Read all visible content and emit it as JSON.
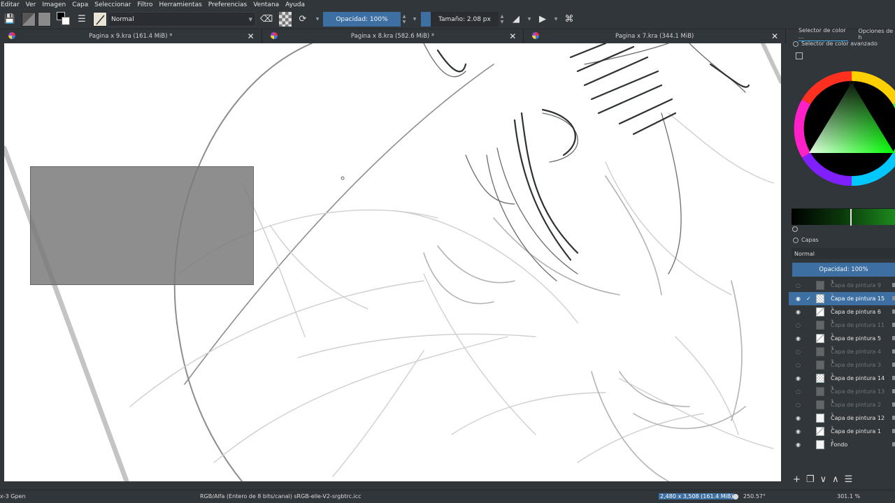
{
  "menu": [
    "Editar",
    "Ver",
    "Imagen",
    "Capa",
    "Seleccionar",
    "Filtro",
    "Herramientas",
    "Preferencias",
    "Ventana",
    "Ayuda"
  ],
  "toolbar": {
    "blend_mode": "Normal",
    "opacity_label": "Opacidad: 100%",
    "size_label": "Tamaño: 2.08 px"
  },
  "tabs": [
    {
      "title": "Pagina x 9.kra (161.4 MiB) *"
    },
    {
      "title": "Pagina x 8.kra (582.6 MiB) *"
    },
    {
      "title": "Pagina x 7.kra (344.1 MiB)"
    }
  ],
  "dock": {
    "tab_color": "Selector de color ...",
    "tab_options": "Opciones de h",
    "color_panel_title": "Selector de color avanzado",
    "layers_title": "Capas",
    "layer_blend": "Normal",
    "layer_opacity": "Opacidad:  100%"
  },
  "layers": [
    {
      "name": "Capa de pintura 9",
      "visible": false,
      "selected": false,
      "checked": false,
      "thumb": "faint"
    },
    {
      "name": "Capa de pintura 15",
      "visible": true,
      "selected": true,
      "checked": true,
      "thumb": "check"
    },
    {
      "name": "Capa de pintura 6",
      "visible": true,
      "selected": false,
      "checked": false,
      "thumb": "sketch"
    },
    {
      "name": "Capa de pintura 11",
      "visible": false,
      "selected": false,
      "checked": false,
      "thumb": "faint"
    },
    {
      "name": "Capa de pintura 5",
      "visible": true,
      "selected": false,
      "checked": false,
      "thumb": "sketch"
    },
    {
      "name": "Capa de pintura 4",
      "visible": false,
      "selected": false,
      "checked": false,
      "thumb": "faint"
    },
    {
      "name": "Capa de pintura 3",
      "visible": false,
      "selected": false,
      "checked": false,
      "thumb": "faint"
    },
    {
      "name": "Capa de pintura 14",
      "visible": true,
      "selected": false,
      "checked": false,
      "thumb": "check"
    },
    {
      "name": "Capa de pintura 13",
      "visible": false,
      "selected": false,
      "checked": false,
      "thumb": "faint"
    },
    {
      "name": "Capa de pintura 2",
      "visible": false,
      "selected": false,
      "checked": false,
      "thumb": "faint"
    },
    {
      "name": "Capa de pintura 12",
      "visible": true,
      "selected": false,
      "checked": false,
      "thumb": "white"
    },
    {
      "name": "Capa de pintura 1",
      "visible": true,
      "selected": false,
      "checked": false,
      "thumb": "sketch"
    },
    {
      "name": "Fondo",
      "visible": true,
      "selected": false,
      "checked": false,
      "thumb": "white"
    }
  ],
  "status": {
    "brush": "x-3 Gpen",
    "color_space": "RGB/Alfa (Entero de 8 bits/canal)  sRGB-elle-V2-srgbtrc.icc",
    "dimensions": "2,480 x 3,508 (161.4 MiB)",
    "angle": "250.57°",
    "zoom": "301.1 %"
  },
  "colors": {
    "accent": "#3d6fa2",
    "panel": "#31363b",
    "canvas": "#ffffff",
    "selection_rect": "#8c8c8c"
  }
}
